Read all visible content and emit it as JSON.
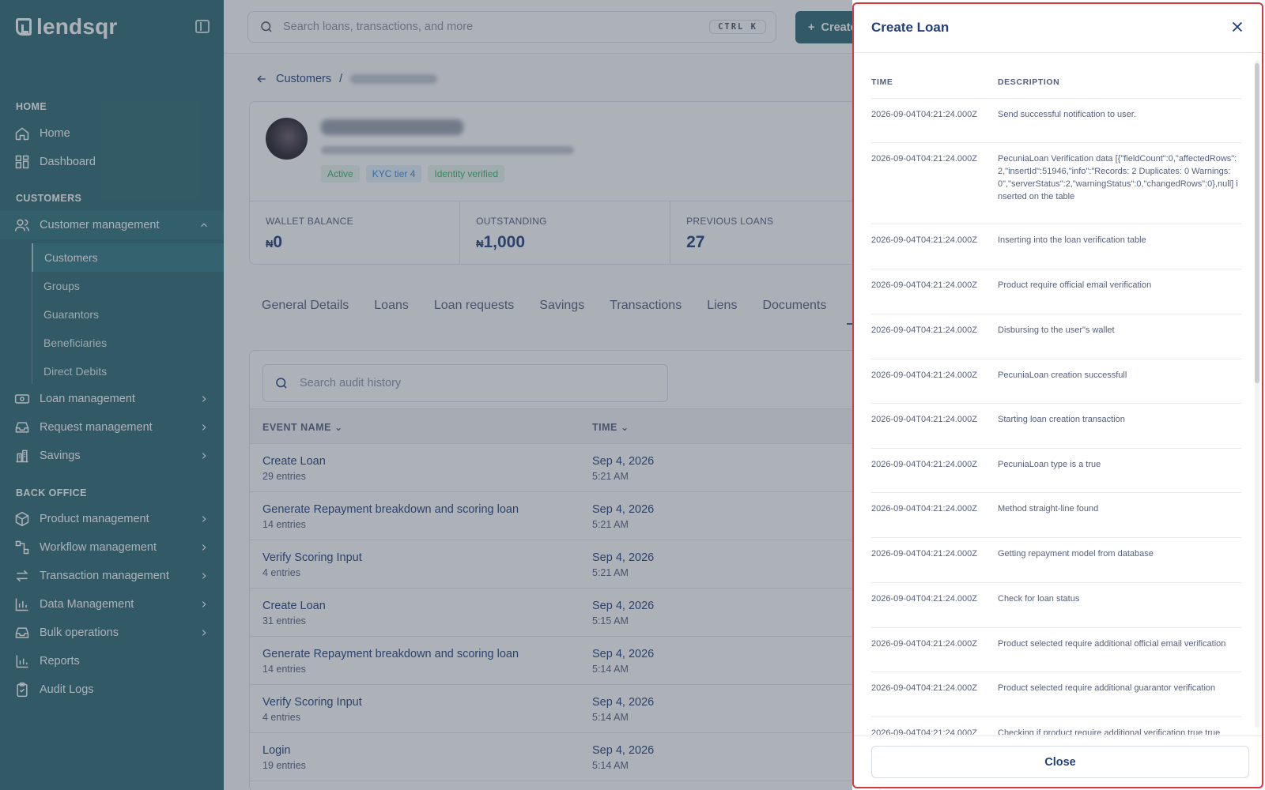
{
  "brand": "lendsqr",
  "sidebar": {
    "sections": [
      {
        "title": "HOME",
        "items": [
          {
            "label": "Home",
            "icon": "home-icon"
          },
          {
            "label": "Dashboard",
            "icon": "dashboard-icon"
          }
        ]
      },
      {
        "title": "CUSTOMERS",
        "items": [
          {
            "label": "Customer management",
            "icon": "users-icon",
            "expanded": true,
            "children": [
              "Customers",
              "Groups",
              "Guarantors",
              "Beneficiaries",
              "Direct Debits"
            ],
            "active_child": "Customers"
          },
          {
            "label": "Loan management",
            "icon": "money-icon"
          },
          {
            "label": "Request management",
            "icon": "inbox-icon"
          },
          {
            "label": "Savings",
            "icon": "bank-icon"
          }
        ]
      },
      {
        "title": "BACK OFFICE",
        "items": [
          {
            "label": "Product management",
            "icon": "box-icon"
          },
          {
            "label": "Workflow management",
            "icon": "workflow-icon"
          },
          {
            "label": "Transaction management",
            "icon": "transfer-icon"
          },
          {
            "label": "Data Management",
            "icon": "chart-icon"
          },
          {
            "label": "Bulk operations",
            "icon": "inbox-icon"
          },
          {
            "label": "Reports",
            "icon": "reports-icon"
          },
          {
            "label": "Audit Logs",
            "icon": "clipboard-icon"
          }
        ]
      }
    ]
  },
  "topbar": {
    "search_placeholder": "Search loans, transactions, and more",
    "shortcut": "CTRL K",
    "create_label": "Create"
  },
  "breadcrumb": {
    "parent": "Customers",
    "separator": "/"
  },
  "profile": {
    "badges": [
      "Active",
      "KYC tier 4",
      "Identity verified"
    ],
    "stats": [
      {
        "label": "WALLET BALANCE",
        "currency": "₦",
        "value": "0"
      },
      {
        "label": "OUTSTANDING",
        "currency": "₦",
        "value": "1,000"
      },
      {
        "label": "PREVIOUS LOANS",
        "currency": "",
        "value": "27"
      }
    ]
  },
  "tabs": [
    "General Details",
    "Loans",
    "Loan requests",
    "Savings",
    "Transactions",
    "Liens",
    "Documents"
  ],
  "audit": {
    "search_placeholder": "Search audit history",
    "columns": [
      "EVENT NAME",
      "TIME"
    ],
    "rows": [
      {
        "event": "Create Loan",
        "entries": "29 entries",
        "date": "Sep 4, 2026",
        "time": "5:21 AM"
      },
      {
        "event": "Generate Repayment breakdown and scoring loan",
        "entries": "14 entries",
        "date": "Sep 4, 2026",
        "time": "5:21 AM"
      },
      {
        "event": "Verify Scoring Input",
        "entries": "4 entries",
        "date": "Sep 4, 2026",
        "time": "5:21 AM"
      },
      {
        "event": "Create Loan",
        "entries": "31 entries",
        "date": "Sep 4, 2026",
        "time": "5:15 AM"
      },
      {
        "event": "Generate Repayment breakdown and scoring loan",
        "entries": "14 entries",
        "date": "Sep 4, 2026",
        "time": "5:14 AM"
      },
      {
        "event": "Verify Scoring Input",
        "entries": "4 entries",
        "date": "Sep 4, 2026",
        "time": "5:14 AM"
      },
      {
        "event": "Login",
        "entries": "19 entries",
        "date": "Sep 4, 2026",
        "time": "5:14 AM"
      }
    ]
  },
  "drawer": {
    "title": "Create Loan",
    "columns": [
      "TIME",
      "DESCRIPTION"
    ],
    "logs": [
      {
        "time": "2026-09-04T04:21:24.000Z",
        "description": "Send successful notification to user."
      },
      {
        "time": "2026-09-04T04:21:24.000Z",
        "description": "PecuniaLoan Verification data [{\"fieldCount\":0,\"affectedRows\":2,\"insertId\":51946,\"info\":\"Records: 2 Duplicates: 0 Warnings: 0\",\"serverStatus\":2,\"warningStatus\":0,\"changedRows\":0},null] inserted on the table"
      },
      {
        "time": "2026-09-04T04:21:24.000Z",
        "description": "Inserting into the loan verification table"
      },
      {
        "time": "2026-09-04T04:21:24.000Z",
        "description": "Product require official email verification"
      },
      {
        "time": "2026-09-04T04:21:24.000Z",
        "description": "Disbursing to the user\"s wallet"
      },
      {
        "time": "2026-09-04T04:21:24.000Z",
        "description": "PecuniaLoan creation successfull"
      },
      {
        "time": "2026-09-04T04:21:24.000Z",
        "description": "Starting loan creation transaction"
      },
      {
        "time": "2026-09-04T04:21:24.000Z",
        "description": "PecuniaLoan type is a true"
      },
      {
        "time": "2026-09-04T04:21:24.000Z",
        "description": "Method straight-line found"
      },
      {
        "time": "2026-09-04T04:21:24.000Z",
        "description": "Getting repayment model from database"
      },
      {
        "time": "2026-09-04T04:21:24.000Z",
        "description": "Check for loan status"
      },
      {
        "time": "2026-09-04T04:21:24.000Z",
        "description": "Product selected require additional official email verification"
      },
      {
        "time": "2026-09-04T04:21:24.000Z",
        "description": "Product selected require additional guarantor verification"
      },
      {
        "time": "2026-09-04T04:21:24.000Z",
        "description": "Checking if product require additional verification true true"
      }
    ],
    "close_label": "Close"
  }
}
